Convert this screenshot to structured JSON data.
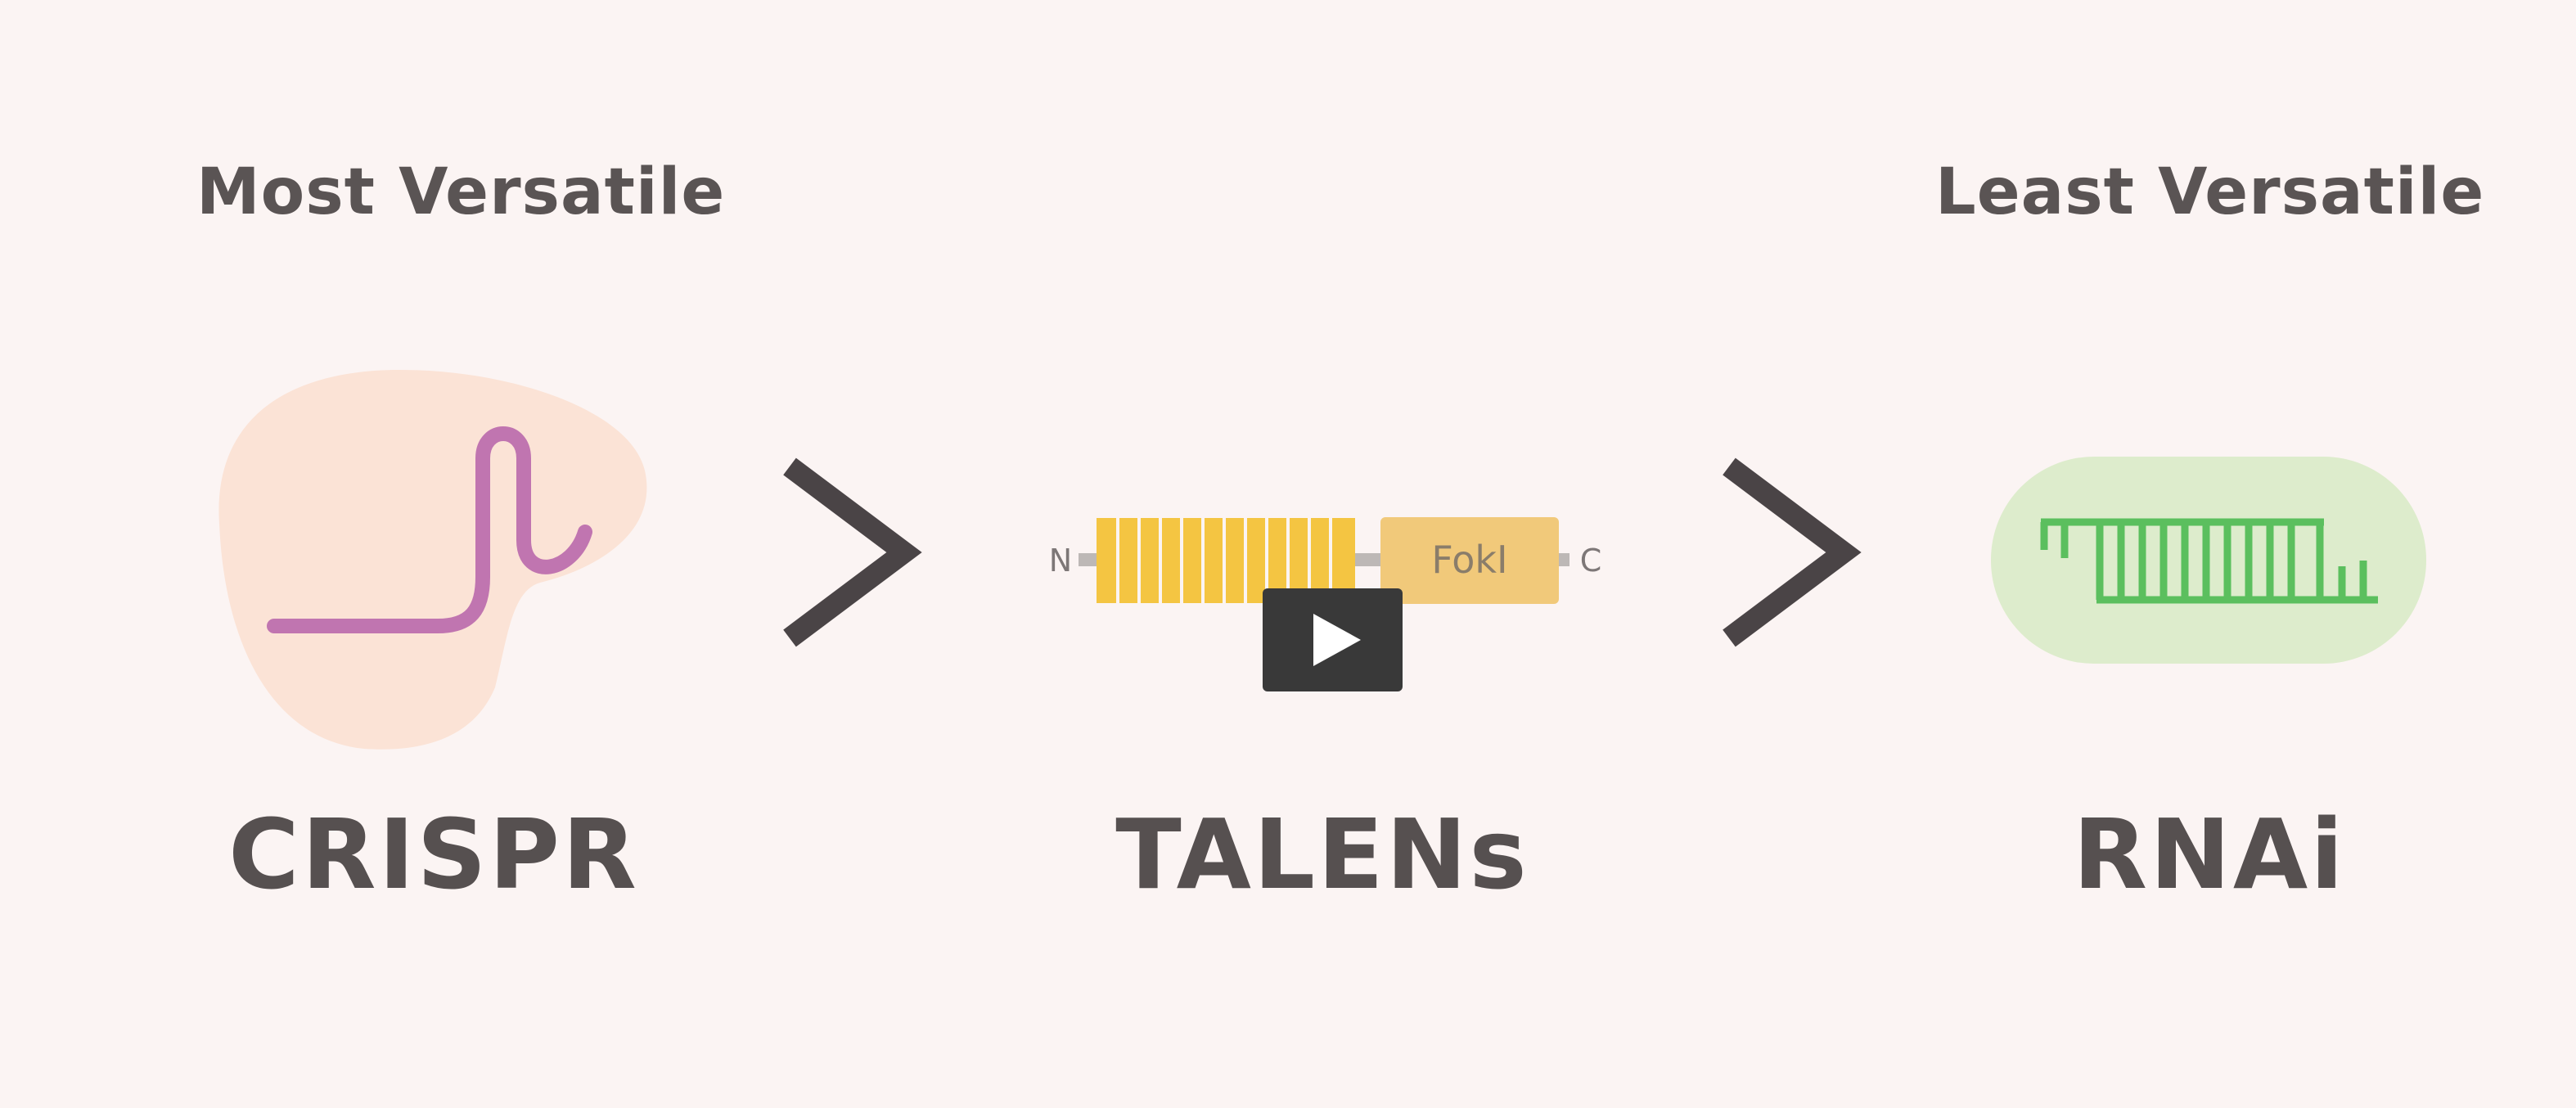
{
  "headings": {
    "left": "Most Versatile",
    "right": "Least Versatile"
  },
  "methods": {
    "crispr": "CRISPR",
    "talens": "TALENs",
    "rnai": "RNAi"
  },
  "talen_diagram": {
    "n_terminus": "N",
    "c_terminus": "C",
    "domain": "FokI"
  },
  "comparison_symbol": "greater-than-chevron",
  "video_control": {
    "icon": "play-icon"
  },
  "colors": {
    "background": "#fbf4f3",
    "text": "#565050",
    "protein_blob": "#fbe3d6",
    "guide_rna": "#c075b0",
    "tale_repeats": "#f4c542",
    "foki_domain": "#f1c97a",
    "rnai_capsule": "#ddeccc",
    "rnai_strand": "#5bbf5e",
    "chevron": "#4a4446"
  }
}
